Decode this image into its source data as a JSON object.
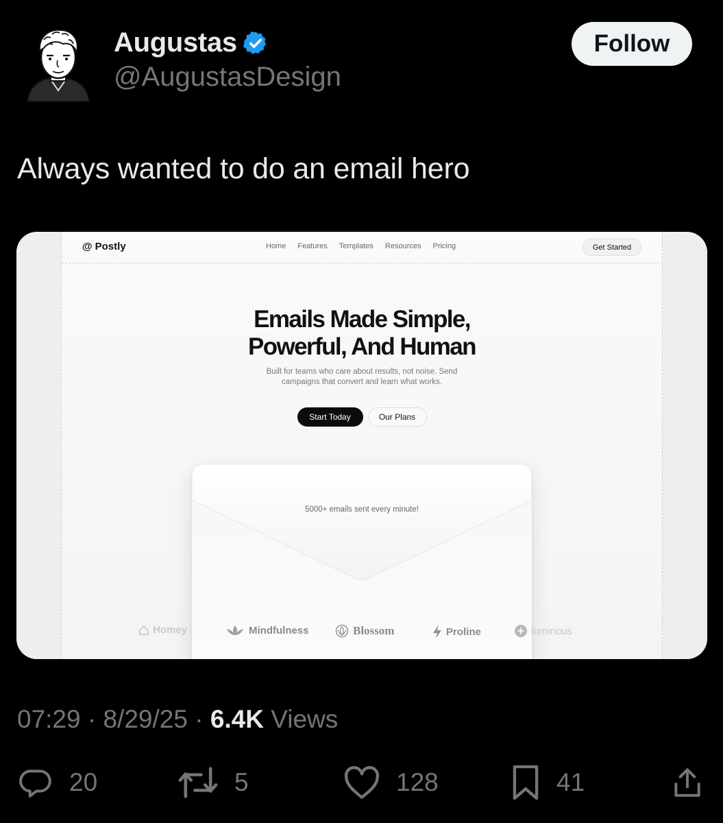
{
  "tweet": {
    "author_name": "Augustas",
    "handle": "@AugustasDesign",
    "follow_label": "Follow",
    "text": "Always wanted to do an email hero",
    "time": "07:29",
    "date": "8/29/25",
    "views_count": "6.4K",
    "views_label": "Views",
    "separator": "·"
  },
  "site": {
    "brand": "Postly",
    "nav": [
      "Home",
      "Features",
      "Templates",
      "Resources",
      "Pricing"
    ],
    "get_started": "Get Started",
    "hero_title_1": "Emails Made Simple,",
    "hero_title_2": "Powerful, And Human",
    "hero_sub_1": "Built for teams who care about results, not noise. Send",
    "hero_sub_2": "campaigns that convert and learn what works.",
    "cta_primary": "Start Today",
    "cta_secondary": "Our Plans",
    "envelope_caption": "5000+ emails sent every minute!",
    "logos": [
      "Homey",
      "Mindfulness",
      "Blossom",
      "Proline",
      "luminous"
    ]
  },
  "actions": {
    "replies": "20",
    "reposts": "5",
    "likes": "128",
    "bookmarks": "41"
  },
  "colors": {
    "background": "#000000",
    "verified": "#1d9bf0",
    "muted": "#71767b",
    "text": "#e7e9ea"
  }
}
